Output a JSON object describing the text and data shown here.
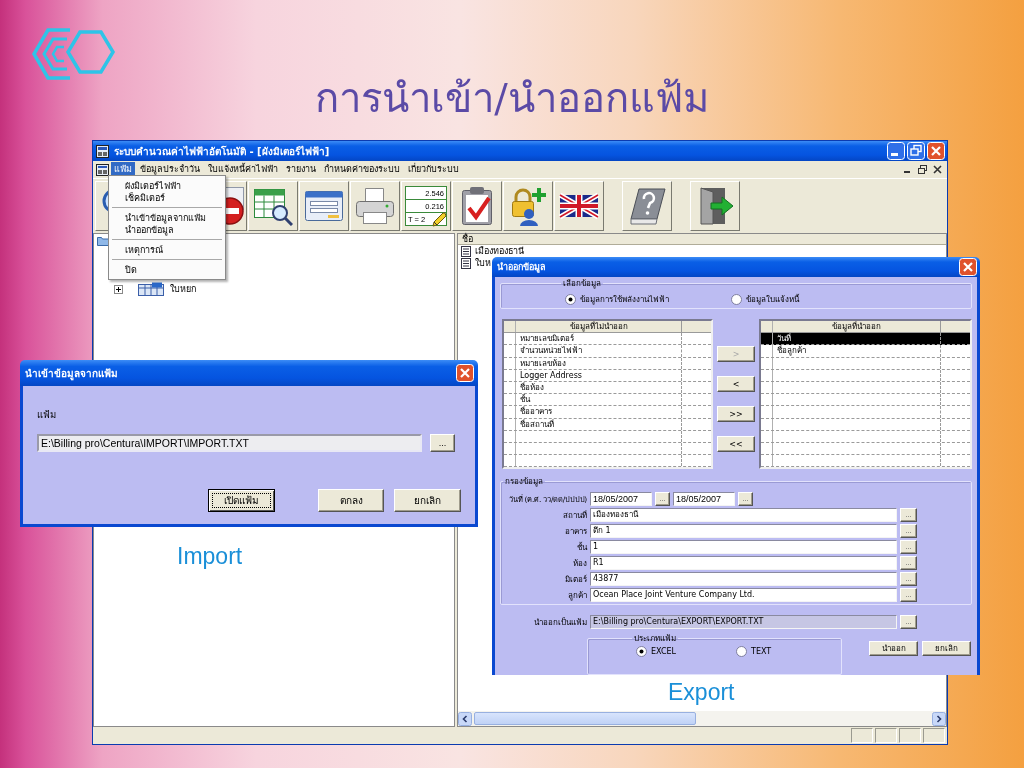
{
  "slide": {
    "title": "การนำเข้า/นำออกแฟ้ม"
  },
  "app_window": {
    "title": "ระบบคำนวณค่าไฟฟ้าอัตโนมัติ - [ผังมิเตอร์ไฟฟ้า]",
    "menu": [
      {
        "label": "แฟ้ม",
        "selected": true
      },
      {
        "label": "ข้อมูลประจำวัน",
        "selected": false
      },
      {
        "label": "ใบแจ้งหนี้ค่าไฟฟ้า",
        "selected": false
      },
      {
        "label": "รายงาน",
        "selected": false
      },
      {
        "label": "กำหนดค่าของระบบ",
        "selected": false
      },
      {
        "label": "เกี่ยวกับระบบ",
        "selected": false
      }
    ],
    "toolbar_readings": [
      "2.546",
      "0.216",
      "T = 2"
    ],
    "file_menu": [
      [
        "ผังมิเตอร์ไฟฟ้า",
        "เช็คมิเตอร์"
      ],
      [
        "นำเข้าข้อมูลจากแฟ้ม",
        "นำออกข้อมูล"
      ],
      [
        "เหตุการณ์"
      ],
      [
        "ปิด"
      ]
    ],
    "tree": [
      {
        "label": "ใบหยก",
        "expanded": false
      }
    ],
    "list": {
      "columns": [
        "ชื่อ"
      ],
      "rows": [
        "เมืองทองธานี",
        "ใบห"
      ]
    }
  },
  "import_dialog": {
    "title": "นำเข้าข้อมูลจากแฟ้ม",
    "file_label": "แฟ้ม",
    "file_path": "E:\\Billing pro\\Centura\\IMPORT\\IMPORT.TXT",
    "browse_button": "...",
    "buttons": [
      {
        "label": "เปิดแฟ้ม",
        "focused": true
      },
      {
        "label": "ตกลง",
        "focused": false
      },
      {
        "label": "ยกเลิก",
        "focused": false
      }
    ],
    "caption": "Import"
  },
  "export_dialog": {
    "title": "นำออกข้อมูล",
    "data_choice": {
      "label": "เลือกข้อมูล",
      "options": [
        {
          "label": "ข้อมูลการใช้พลังงานไฟฟ้า",
          "selected": true
        },
        {
          "label": "ข้อมูลใบแจ้งหนี้",
          "selected": false
        }
      ]
    },
    "available": {
      "header": "ข้อมูลที่ไม่นำออก",
      "rows": [
        {
          "label": "หมายเลขมิเตอร์",
          "selected": false
        },
        {
          "label": "จำนวนหน่วยไฟฟ้า",
          "selected": false
        },
        {
          "label": "หมายเลขห้อง",
          "selected": false
        },
        {
          "label": "Logger Address",
          "selected": false
        },
        {
          "label": "ชื่อห้อง",
          "selected": false
        },
        {
          "label": "ชั้น",
          "selected": false
        },
        {
          "label": "ชื่ออาคาร",
          "selected": false
        },
        {
          "label": "ชื่อสถานที่",
          "selected": false
        }
      ]
    },
    "move_buttons": [
      {
        "label": ">",
        "disabled": true
      },
      {
        "label": "<",
        "disabled": false
      },
      {
        "label": ">>",
        "disabled": false
      },
      {
        "label": "<<",
        "disabled": false
      }
    ],
    "chosen": {
      "header": "ข้อมูลที่นำออก",
      "rows": [
        {
          "label": "วันที่",
          "selected": true
        },
        {
          "label": "ชื่อลูกค้า",
          "selected": false
        }
      ]
    },
    "filter": {
      "label": "กรองข้อมูล",
      "date": {
        "label": "วันที่ (ค.ศ. วว/ดด/ปปปป)",
        "from": "18/05/2007",
        "from_button": "...",
        "to": "18/05/2007",
        "to_button": "..."
      },
      "fields": [
        {
          "label": "สถานที่",
          "value": "เมืองทองธานี",
          "button": "..."
        },
        {
          "label": "อาคาร",
          "value": "ตึก 1",
          "button": "..."
        },
        {
          "label": "ชั้น",
          "value": "1",
          "button": "..."
        },
        {
          "label": "ห้อง",
          "value": "R1",
          "button": "..."
        },
        {
          "label": "มิเตอร์",
          "value": "43877",
          "button": "..."
        },
        {
          "label": "ลูกค้า",
          "value": "Ocean Place Joint Venture Company Ltd.",
          "button": "..."
        }
      ]
    },
    "output": {
      "label": "นำออกเป็นแฟ้ม",
      "value": "E:\\Billing pro\\Centura\\EXPORT\\EXPORT.TXT",
      "disabled": true,
      "button": "..."
    },
    "file_type": {
      "label": "ประเภทแฟ้ม",
      "options": [
        {
          "label": "EXCEL",
          "selected": true
        },
        {
          "label": "TEXT",
          "selected": false
        }
      ]
    },
    "buttons": [
      "นำออก",
      "ยกเลิก"
    ],
    "caption": "Export"
  }
}
